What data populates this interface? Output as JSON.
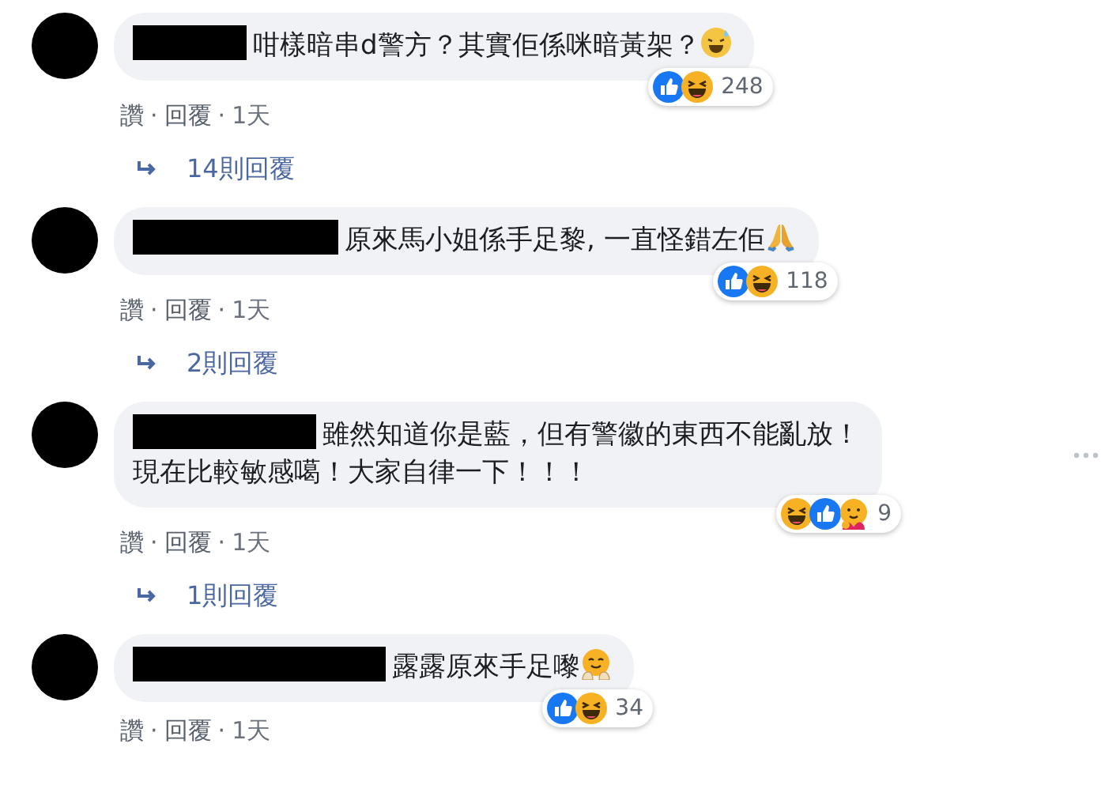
{
  "comments": [
    {
      "name_redacted": true,
      "lines": [
        "咁樣暗串d警方？其實佢係咪暗黃架？"
      ],
      "emoji": {
        "kind": "sweat-smile"
      },
      "reactions": [
        {
          "kind": "like"
        },
        {
          "kind": "haha"
        }
      ],
      "reaction_count": "248",
      "actions": [
        {
          "kind": "link",
          "label": "讚"
        },
        {
          "kind": "separator",
          "label": "·"
        },
        {
          "kind": "link",
          "label": "回覆"
        },
        {
          "kind": "separator",
          "label": "·"
        },
        {
          "kind": "time",
          "label": "1天"
        }
      ],
      "replies": "14則回覆",
      "more_menu": false
    },
    {
      "name_redacted": true,
      "lines": [
        "原來馬小姐係手足黎, 一直怪錯左佢"
      ],
      "emoji": {
        "kind": "pray"
      },
      "reactions": [
        {
          "kind": "like"
        },
        {
          "kind": "haha"
        }
      ],
      "reaction_count": "118",
      "actions": [
        {
          "kind": "link",
          "label": "讚"
        },
        {
          "kind": "separator",
          "label": "·"
        },
        {
          "kind": "link",
          "label": "回覆"
        },
        {
          "kind": "separator",
          "label": "·"
        },
        {
          "kind": "time",
          "label": "1天"
        }
      ],
      "replies": "2則回覆",
      "more_menu": false
    },
    {
      "name_redacted": true,
      "lines": [
        "雖然知道你是藍，但有警徽的東西不能亂放！",
        "現在比較敏感噶！大家自律一下！！！"
      ],
      "reactions": [
        {
          "kind": "haha"
        },
        {
          "kind": "like"
        },
        {
          "kind": "care"
        }
      ],
      "reaction_count": "9",
      "actions": [
        {
          "kind": "link",
          "label": "讚"
        },
        {
          "kind": "separator",
          "label": "·"
        },
        {
          "kind": "link",
          "label": "回覆"
        },
        {
          "kind": "separator",
          "label": "·"
        },
        {
          "kind": "time",
          "label": "1天"
        }
      ],
      "replies": "1則回覆",
      "more_menu": true
    },
    {
      "name_redacted": true,
      "lines": [
        "露露原來手足嚟"
      ],
      "emoji": {
        "kind": "hug"
      },
      "reactions": [
        {
          "kind": "like"
        },
        {
          "kind": "haha"
        }
      ],
      "reaction_count": "34",
      "actions": [
        {
          "kind": "link",
          "label": "讚"
        },
        {
          "kind": "separator",
          "label": "·"
        },
        {
          "kind": "link",
          "label": "回覆"
        },
        {
          "kind": "separator",
          "label": "·"
        },
        {
          "kind": "time",
          "label": "1天"
        }
      ],
      "more_menu": false
    }
  ]
}
